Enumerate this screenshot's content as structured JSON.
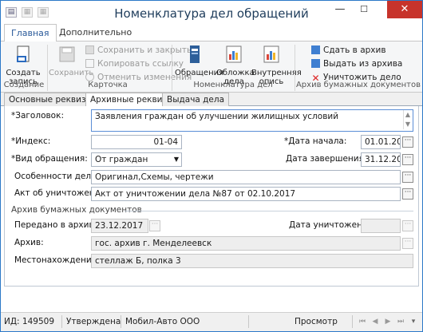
{
  "window": {
    "title": "Номенклатура дел обращений",
    "min": "—",
    "max": "☐",
    "close": "✕"
  },
  "ribbon_tabs": {
    "home": "Главная",
    "extra": "Дополнительно"
  },
  "ribbon": {
    "create": "Создать\nзапись",
    "save": "Сохранить",
    "save_close": "Сохранить и закрыть",
    "copy_link": "Копировать ссылку",
    "undo": "Отменить изменения",
    "obrasheniya": "Обращения",
    "oblozhka": "Обложка\nдела",
    "vnutr": "Внутренняя\nопись",
    "sdat": "Сдать в архив",
    "vydat": "Выдать из архива",
    "unichtozhit": "Уничтожить дело",
    "groups": {
      "g1": "Создание",
      "g2": "Карточка",
      "g3": "Номенклатура дел",
      "g4": "Архив бумажных документов"
    }
  },
  "doc_tabs": [
    "Основные реквизиты",
    "Архивные реквизиты",
    "Выдача дела"
  ],
  "form": {
    "zagolovok_lbl": "*Заголовок:",
    "zagolovok": "Заявления граждан об улучшении жилищных условий",
    "index_lbl": "*Индекс:",
    "index": "01-04",
    "date_start_lbl": "*Дата начала:",
    "date_start": "01.01.2016",
    "vid_lbl": "*Вид обращения:",
    "vid": "От граждан",
    "date_end_lbl": "Дата завершения:",
    "date_end": "31.12.2016",
    "osob_lbl": "Особенности дела:",
    "osob": "Оригинал,Схемы, чертежи",
    "akt_lbl": "Акт об уничтожении:",
    "akt": "Акт от уничтожении дела №87 от 02.10.2017",
    "archive_title": "Архив бумажных документов",
    "peredano_lbl": "Передано в архив:",
    "peredano": "23.12.2017",
    "date_destr_lbl": "Дата уничтожения:",
    "date_destr": "",
    "arhiv_lbl": "Архив:",
    "arhiv": "гос. архив г. Менделеевск",
    "mesto_lbl": "Местонахождение:",
    "mesto": "стеллаж Б, полка 3"
  },
  "status": {
    "id": "ИД: 149509",
    "state": "Утверждена",
    "org": "Мобил-Авто ООО",
    "mode": "Просмотр"
  }
}
